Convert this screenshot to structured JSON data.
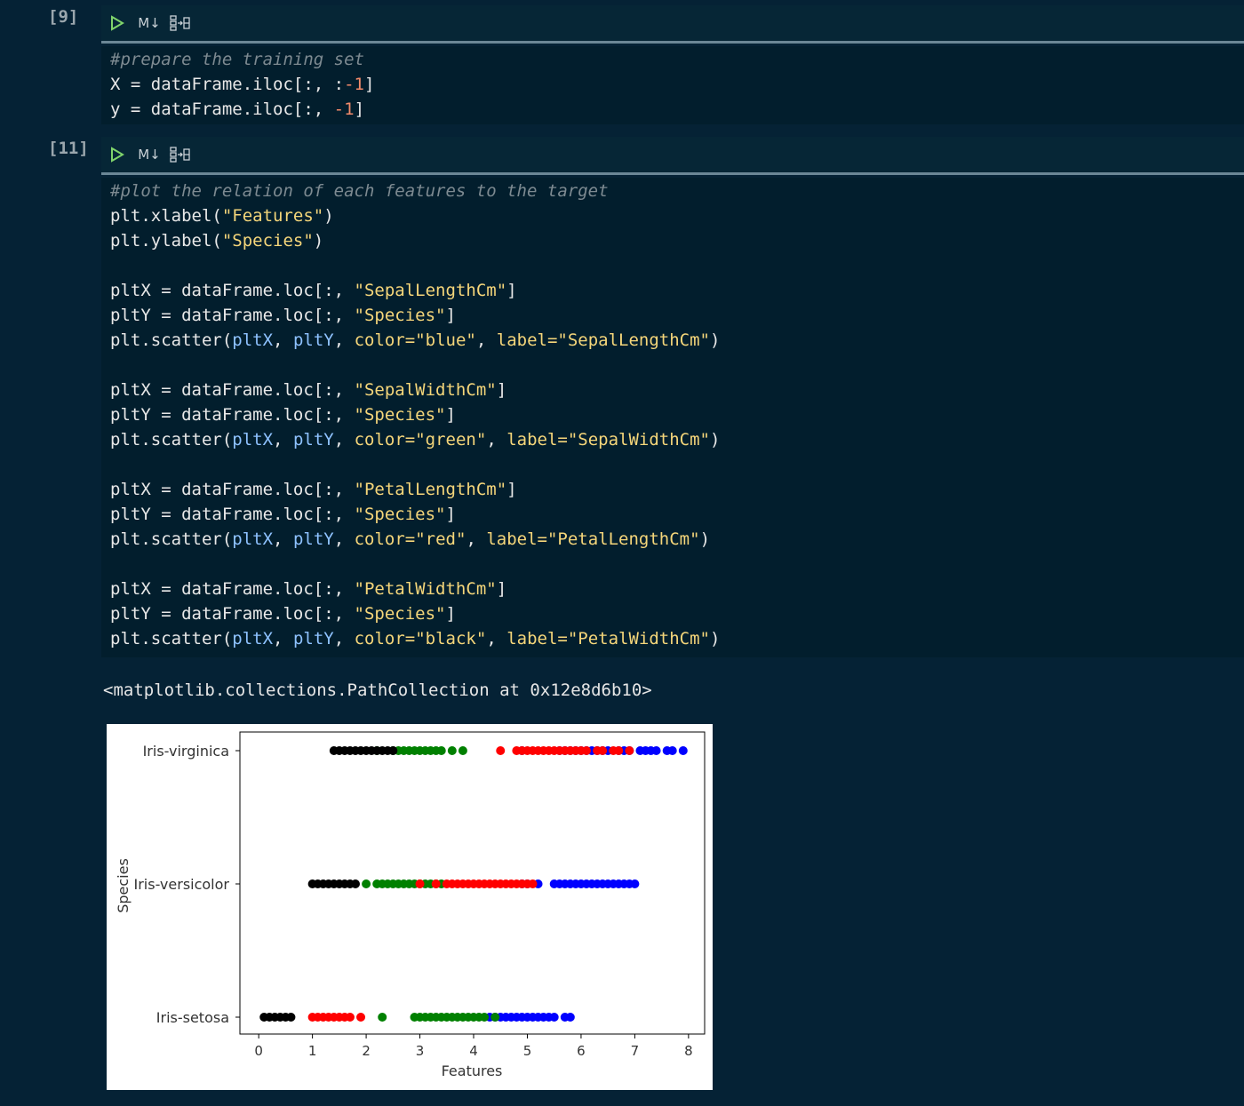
{
  "cells": [
    {
      "exec_count": "[9]",
      "toolbar": {
        "run_icon": "play-icon",
        "markdown_label": "M↓",
        "split_icon": "split-cell-icon"
      },
      "lines": [
        [
          [
            "cm",
            "#prepare the training set"
          ]
        ],
        [
          [
            "tx",
            "X = dataFrame.iloc[:, :"
          ],
          [
            "nm",
            "-1"
          ],
          [
            "tx",
            "]"
          ]
        ],
        [
          [
            "tx",
            "y = dataFrame.iloc[:, "
          ],
          [
            "nm",
            "-1"
          ],
          [
            "tx",
            "]"
          ]
        ]
      ]
    },
    {
      "exec_count": "[11]",
      "toolbar": {
        "run_icon": "play-icon",
        "markdown_label": "M↓",
        "split_icon": "split-cell-icon"
      },
      "lines": [
        [
          [
            "cm",
            "#plot the relation of each features to the target"
          ]
        ],
        [
          [
            "tx",
            "plt.xlabel("
          ],
          [
            "st",
            "\"Features\""
          ],
          [
            "tx",
            ")"
          ]
        ],
        [
          [
            "tx",
            "plt.ylabel("
          ],
          [
            "st",
            "\"Species\""
          ],
          [
            "tx",
            ")"
          ]
        ],
        [],
        [
          [
            "tx",
            "pltX = dataFrame.loc[:, "
          ],
          [
            "st",
            "\"SepalLengthCm\""
          ],
          [
            "tx",
            "]"
          ]
        ],
        [
          [
            "tx",
            "pltY = dataFrame.loc[:, "
          ],
          [
            "st",
            "\"Species\""
          ],
          [
            "tx",
            "]"
          ]
        ],
        [
          [
            "tx",
            "plt.scatter("
          ],
          [
            "vr",
            "pltX"
          ],
          [
            "tx",
            ", "
          ],
          [
            "vr",
            "pltY"
          ],
          [
            "tx",
            ", "
          ],
          [
            "kw",
            "color="
          ],
          [
            "st",
            "\"blue\""
          ],
          [
            "tx",
            ", "
          ],
          [
            "kw",
            "label="
          ],
          [
            "st",
            "\"SepalLengthCm\""
          ],
          [
            "tx",
            ")"
          ]
        ],
        [],
        [
          [
            "tx",
            "pltX = dataFrame.loc[:, "
          ],
          [
            "st",
            "\"SepalWidthCm\""
          ],
          [
            "tx",
            "]"
          ]
        ],
        [
          [
            "tx",
            "pltY = dataFrame.loc[:, "
          ],
          [
            "st",
            "\"Species\""
          ],
          [
            "tx",
            "]"
          ]
        ],
        [
          [
            "tx",
            "plt.scatter("
          ],
          [
            "vr",
            "pltX"
          ],
          [
            "tx",
            ", "
          ],
          [
            "vr",
            "pltY"
          ],
          [
            "tx",
            ", "
          ],
          [
            "kw",
            "color="
          ],
          [
            "st",
            "\"green\""
          ],
          [
            "tx",
            ", "
          ],
          [
            "kw",
            "label="
          ],
          [
            "st",
            "\"SepalWidthCm\""
          ],
          [
            "tx",
            ")"
          ]
        ],
        [],
        [
          [
            "tx",
            "pltX = dataFrame.loc[:, "
          ],
          [
            "st",
            "\"PetalLengthCm\""
          ],
          [
            "tx",
            "]"
          ]
        ],
        [
          [
            "tx",
            "pltY = dataFrame.loc[:, "
          ],
          [
            "st",
            "\"Species\""
          ],
          [
            "tx",
            "]"
          ]
        ],
        [
          [
            "tx",
            "plt.scatter("
          ],
          [
            "vr",
            "pltX"
          ],
          [
            "tx",
            ", "
          ],
          [
            "vr",
            "pltY"
          ],
          [
            "tx",
            ", "
          ],
          [
            "kw",
            "color="
          ],
          [
            "st",
            "\"red\""
          ],
          [
            "tx",
            ", "
          ],
          [
            "kw",
            "label="
          ],
          [
            "st",
            "\"PetalLengthCm\""
          ],
          [
            "tx",
            ")"
          ]
        ],
        [],
        [
          [
            "tx",
            "pltX = dataFrame.loc[:, "
          ],
          [
            "st",
            "\"PetalWidthCm\""
          ],
          [
            "tx",
            "]"
          ]
        ],
        [
          [
            "tx",
            "pltY = dataFrame.loc[:, "
          ],
          [
            "st",
            "\"Species\""
          ],
          [
            "tx",
            "]"
          ]
        ],
        [
          [
            "tx",
            "plt.scatter("
          ],
          [
            "vr",
            "pltX"
          ],
          [
            "tx",
            ", "
          ],
          [
            "vr",
            "pltY"
          ],
          [
            "tx",
            ", "
          ],
          [
            "kw",
            "color="
          ],
          [
            "st",
            "\"black\""
          ],
          [
            "tx",
            ", "
          ],
          [
            "kw",
            "label="
          ],
          [
            "st",
            "\"PetalWidthCm\""
          ],
          [
            "tx",
            ")"
          ]
        ]
      ]
    }
  ],
  "output": {
    "text": "<matplotlib.collections.PathCollection at 0x12e8d6b10>"
  },
  "colors": {
    "background": "#052235",
    "code_background": "#021e2d",
    "comment": "#7d8a91",
    "string": "#f5d67a",
    "number": "#f28b6b",
    "variable": "#8ec2ff"
  },
  "chart_data": {
    "type": "scatter",
    "title": "",
    "xlabel": "Features",
    "ylabel": "Species",
    "categories": [
      "Iris-setosa",
      "Iris-versicolor",
      "Iris-virginica"
    ],
    "xticks": [
      "0",
      "1",
      "2",
      "3",
      "4",
      "5",
      "6",
      "7",
      "8"
    ],
    "xlim": [
      -0.35,
      8.3
    ],
    "grid": false,
    "series": [
      {
        "color": "blue",
        "points": [
          {
            "species": "Iris-setosa",
            "values": [
              4.3,
              4.4,
              4.5,
              4.6,
              4.7,
              4.8,
              4.9,
              5.0,
              5.1,
              5.2,
              5.3,
              5.4,
              5.5,
              5.7,
              5.8
            ]
          },
          {
            "species": "Iris-versicolor",
            "values": [
              4.9,
              5.0,
              5.2,
              5.5,
              5.6,
              5.7,
              5.8,
              5.9,
              6.0,
              6.1,
              6.2,
              6.3,
              6.4,
              6.5,
              6.6,
              6.7,
              6.8,
              6.9,
              7.0
            ]
          },
          {
            "species": "Iris-virginica",
            "values": [
              4.9,
              5.6,
              5.7,
              5.8,
              5.9,
              6.0,
              6.1,
              6.2,
              6.3,
              6.4,
              6.5,
              6.7,
              6.8,
              6.9,
              7.1,
              7.2,
              7.3,
              7.4,
              7.6,
              7.7,
              7.9
            ]
          }
        ]
      },
      {
        "color": "green",
        "points": [
          {
            "species": "Iris-setosa",
            "values": [
              2.3,
              2.9,
              3.0,
              3.1,
              3.2,
              3.3,
              3.4,
              3.5,
              3.6,
              3.7,
              3.8,
              3.9,
              4.0,
              4.1,
              4.2,
              4.4
            ]
          },
          {
            "species": "Iris-versicolor",
            "values": [
              2.0,
              2.2,
              2.3,
              2.4,
              2.5,
              2.6,
              2.7,
              2.8,
              2.9,
              3.0,
              3.1,
              3.2,
              3.3,
              3.4
            ]
          },
          {
            "species": "Iris-virginica",
            "values": [
              2.2,
              2.5,
              2.6,
              2.7,
              2.8,
              2.9,
              3.0,
              3.1,
              3.2,
              3.3,
              3.4,
              3.6,
              3.8
            ]
          }
        ]
      },
      {
        "color": "red",
        "points": [
          {
            "species": "Iris-setosa",
            "values": [
              1.0,
              1.1,
              1.2,
              1.3,
              1.4,
              1.5,
              1.6,
              1.7,
              1.9
            ]
          },
          {
            "species": "Iris-versicolor",
            "values": [
              3.0,
              3.3,
              3.5,
              3.6,
              3.7,
              3.8,
              3.9,
              4.0,
              4.1,
              4.2,
              4.3,
              4.4,
              4.5,
              4.6,
              4.7,
              4.8,
              4.9,
              5.0,
              5.1
            ]
          },
          {
            "species": "Iris-virginica",
            "values": [
              4.5,
              4.8,
              4.9,
              5.0,
              5.1,
              5.2,
              5.3,
              5.4,
              5.5,
              5.6,
              5.7,
              5.8,
              5.9,
              6.0,
              6.1,
              6.3,
              6.4,
              6.6,
              6.7,
              6.9
            ]
          }
        ]
      },
      {
        "color": "black",
        "points": [
          {
            "species": "Iris-setosa",
            "values": [
              0.1,
              0.2,
              0.3,
              0.4,
              0.5,
              0.6
            ]
          },
          {
            "species": "Iris-versicolor",
            "values": [
              1.0,
              1.1,
              1.2,
              1.3,
              1.4,
              1.5,
              1.6,
              1.7,
              1.8
            ]
          },
          {
            "species": "Iris-virginica",
            "values": [
              1.4,
              1.5,
              1.6,
              1.7,
              1.8,
              1.9,
              2.0,
              2.1,
              2.2,
              2.3,
              2.4,
              2.5
            ]
          }
        ]
      }
    ]
  }
}
